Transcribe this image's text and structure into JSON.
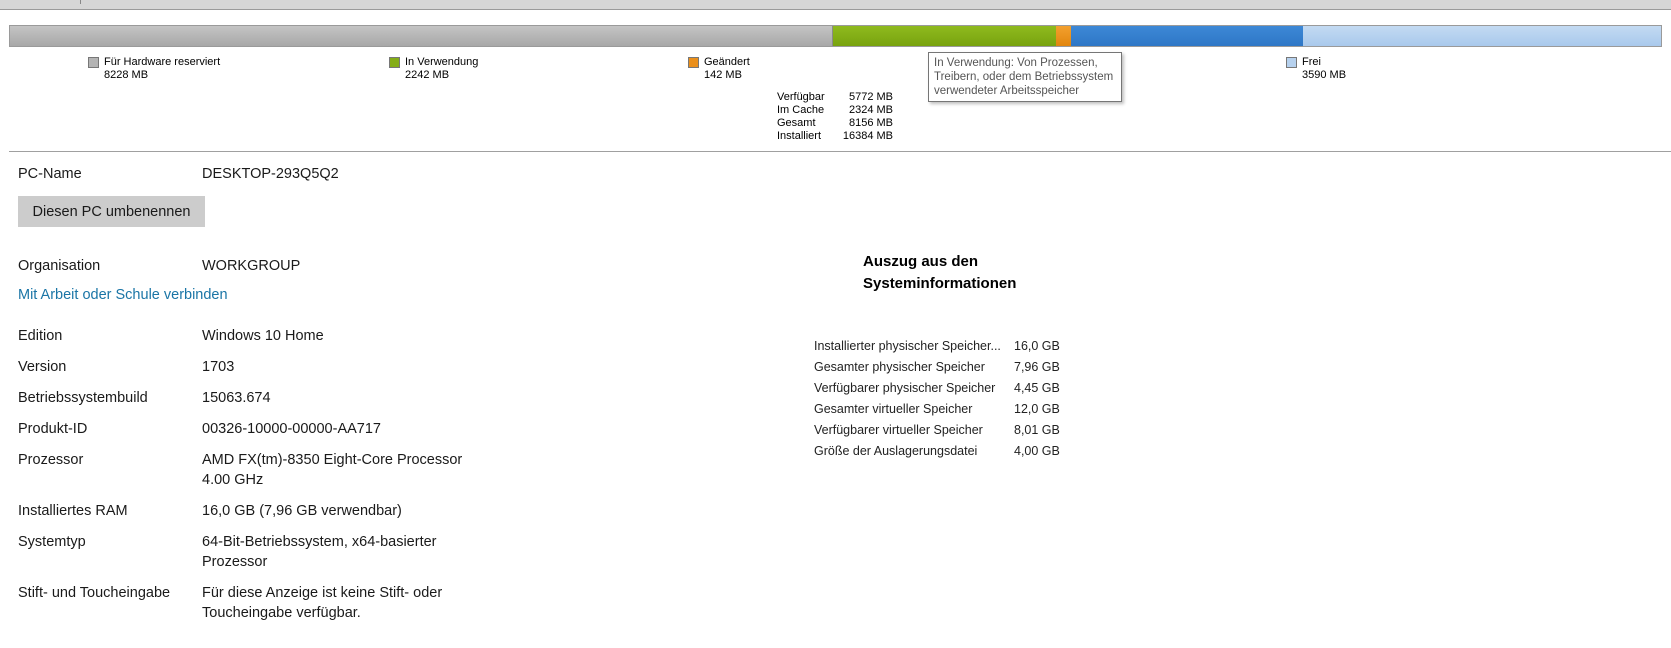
{
  "memory": {
    "legend": [
      {
        "label": "Für Hardware reserviert",
        "value": "8228 MB",
        "color": "#b4b4b4"
      },
      {
        "label": "In Verwendung",
        "value": "2242 MB",
        "color": "#84ad17"
      },
      {
        "label": "Geändert",
        "value": "142 MB",
        "color": "#ea8f1b"
      },
      {
        "label": "Frei",
        "value": "3590 MB",
        "color": "#b6d1ee"
      }
    ],
    "standby_color": "#3580cf",
    "stats": [
      {
        "label": "Verfügbar",
        "value": "5772 MB"
      },
      {
        "label": "Im Cache",
        "value": "2324 MB"
      },
      {
        "label": "Gesamt",
        "value": "8156 MB"
      },
      {
        "label": "Installiert",
        "value": "16384 MB"
      }
    ],
    "tooltip": "In Verwendung: Von Prozessen, Treibern, oder dem Betriebssystem verwendeter Arbeitsspeicher"
  },
  "system": {
    "pc_name_label": "PC-Name",
    "pc_name_value": "DESKTOP-293Q5Q2",
    "rename_button": "Diesen PC umbenennen",
    "organisation_label": "Organisation",
    "organisation_value": "WORKGROUP",
    "connect_link": "Mit Arbeit oder Schule verbinden",
    "edition_label": "Edition",
    "edition_value": "Windows 10 Home",
    "version_label": "Version",
    "version_value": "1703",
    "build_label": "Betriebssystembuild",
    "build_value": "15063.674",
    "product_id_label": "Produkt-ID",
    "product_id_value": "00326-10000-00000-AA717",
    "processor_label": "Prozessor",
    "processor_value": "AMD FX(tm)-8350 Eight-Core Processor 4.00 GHz",
    "ram_label": "Installiertes RAM",
    "ram_value": "16,0 GB (7,96 GB verwendbar)",
    "systemtype_label": "Systemtyp",
    "systemtype_value": "64-Bit-Betriebssystem, x64-basierter Prozessor",
    "pen_label": "Stift- und Toucheingabe",
    "pen_value": "Für diese Anzeige ist keine Stift- oder Toucheingabe verfügbar."
  },
  "sysinfo": {
    "title": "Auszug aus den Systeminformationen",
    "rows": [
      {
        "label": "Installierter physischer Speicher...",
        "value": "16,0 GB"
      },
      {
        "label": "Gesamter physischer Speicher",
        "value": "7,96 GB"
      },
      {
        "label": "Verfügbarer physischer Speicher",
        "value": "4,45 GB"
      },
      {
        "label": "Gesamter virtueller Speicher",
        "value": "12,0 GB"
      },
      {
        "label": "Verfügbarer virtueller Speicher",
        "value": "8,01 GB"
      },
      {
        "label": "Größe der Auslagerungsdatei",
        "value": "4,00 GB"
      }
    ]
  }
}
